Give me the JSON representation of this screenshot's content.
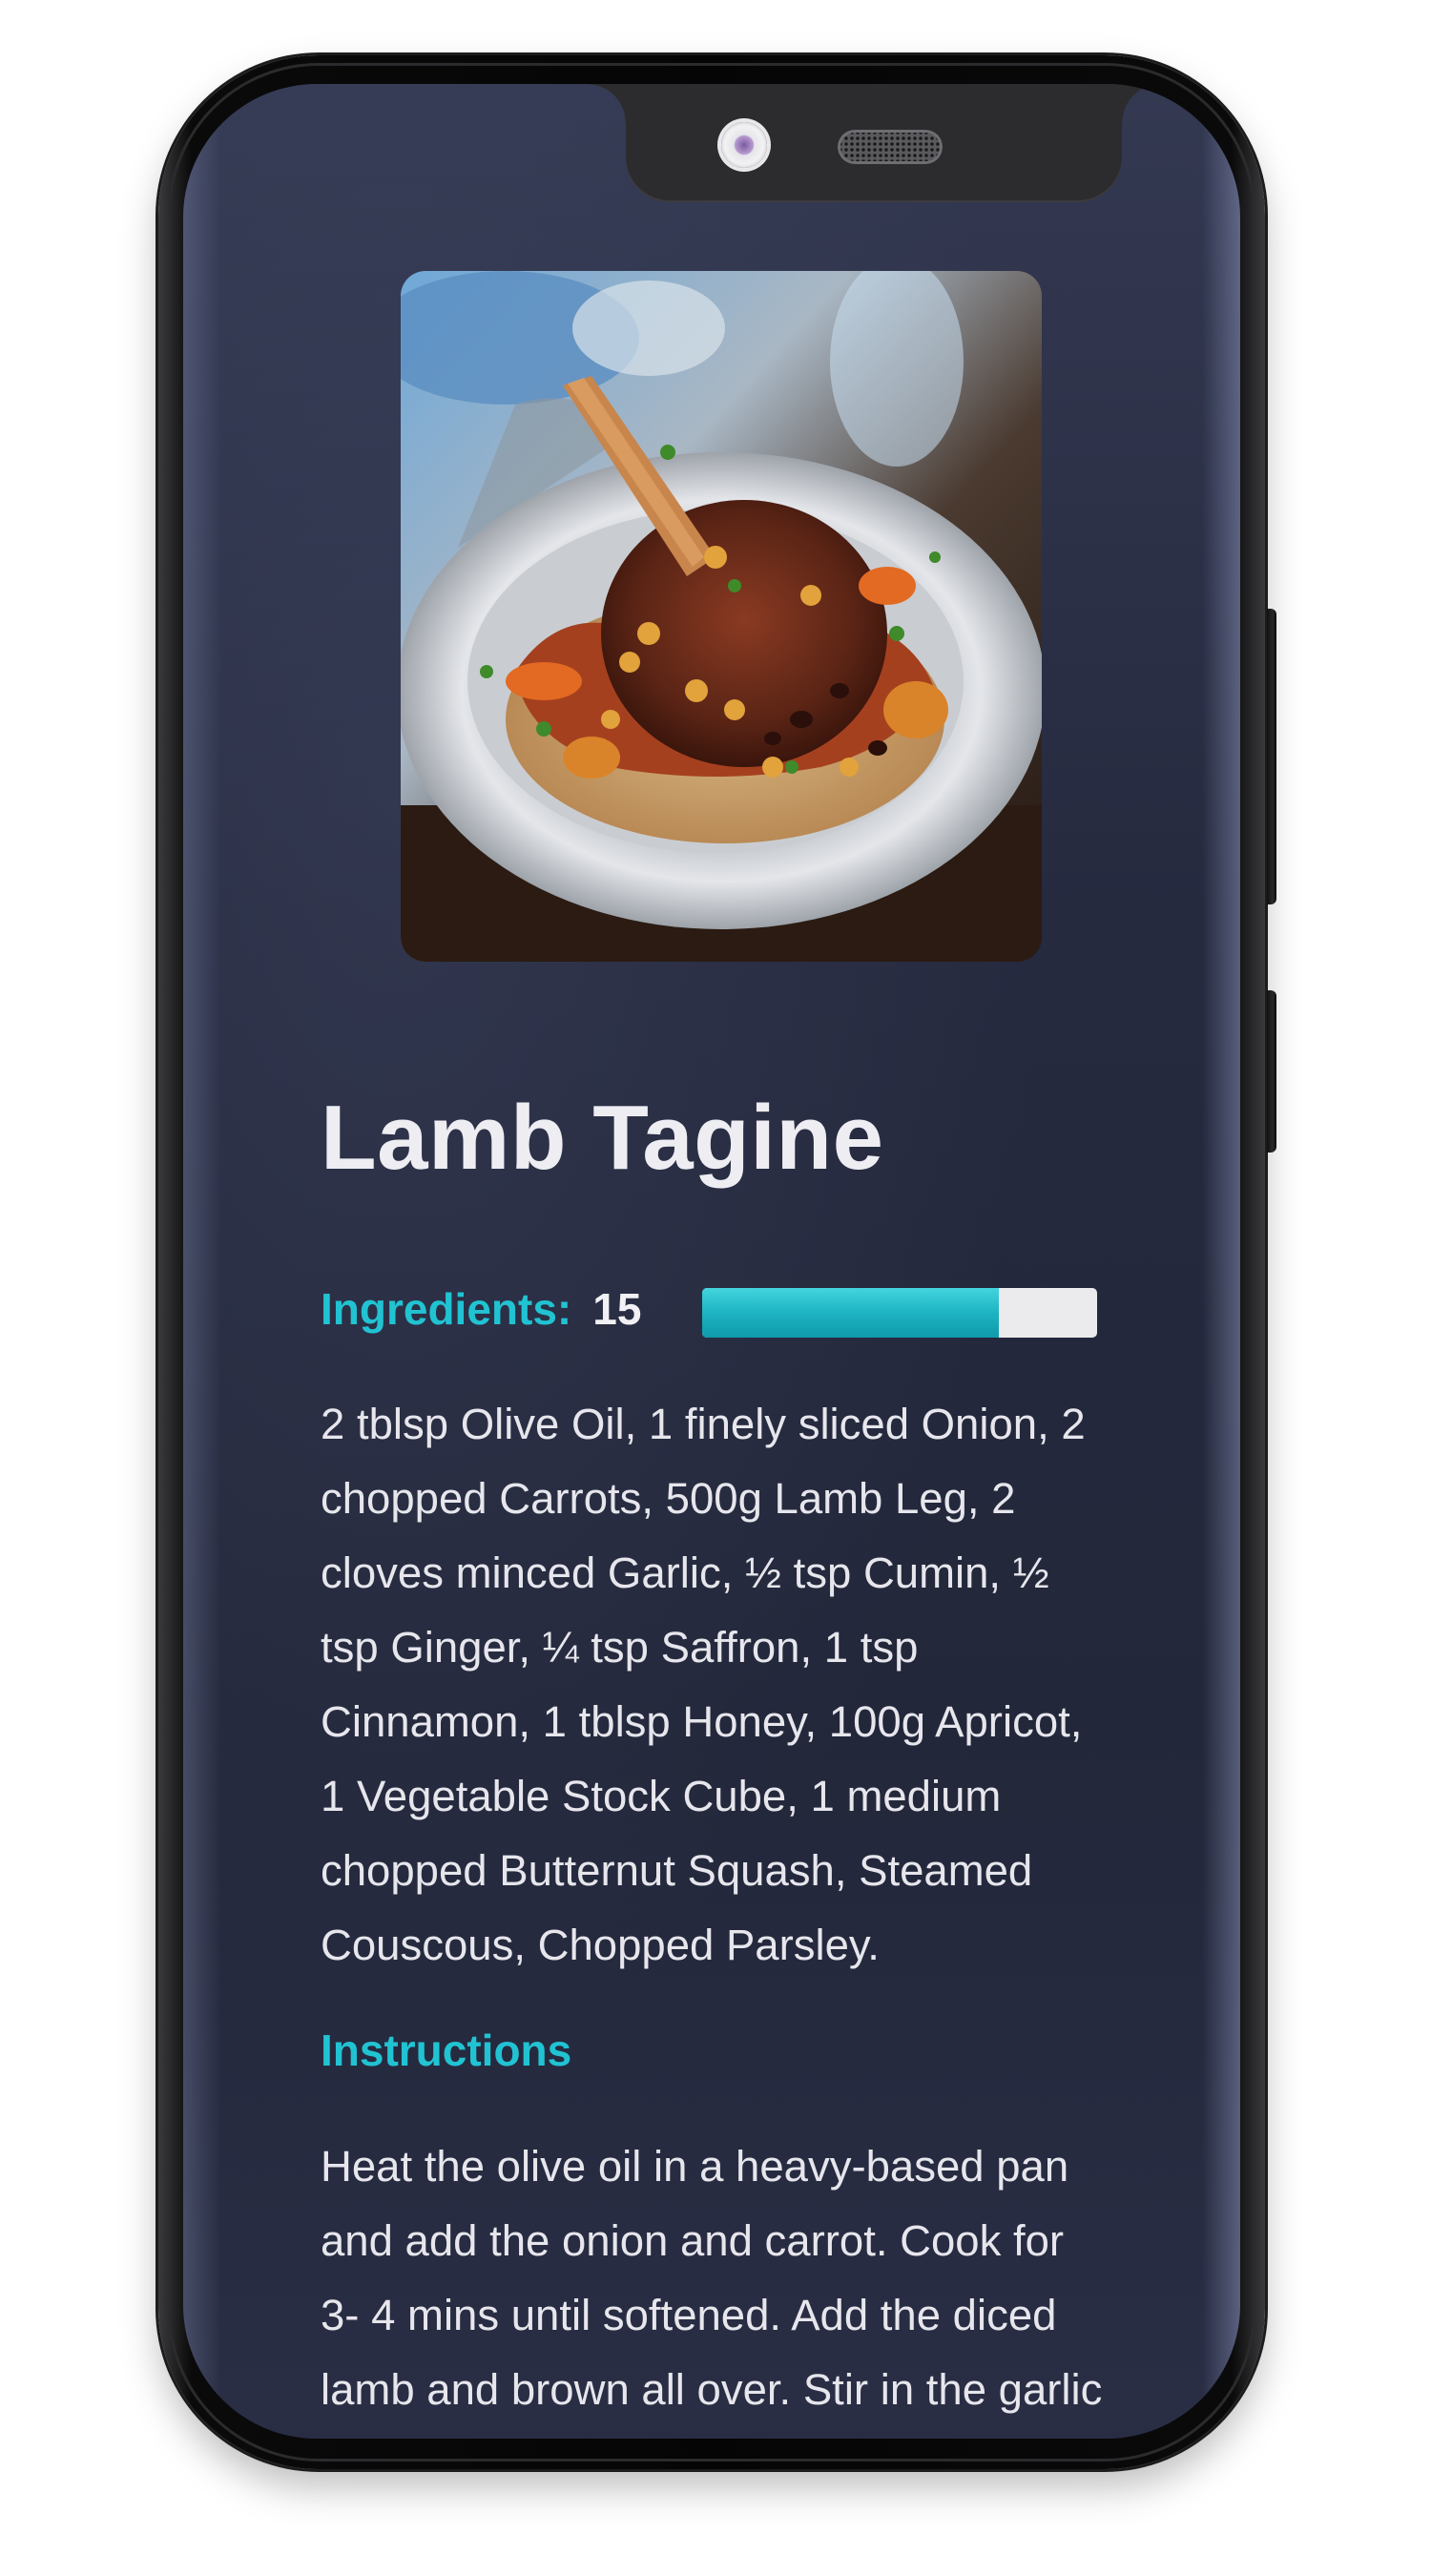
{
  "recipe": {
    "title": "Lamb Tagine",
    "photo_icon": "dish-photo",
    "ingredients_label": "Ingredients:",
    "ingredients_count": "15",
    "ingredients_progress_fraction": 0.75,
    "ingredients_text": "2 tblsp Olive Oil, 1 finely sliced Onion, 2 chopped Carrots, 500g Lamb Leg, 2 cloves minced Garlic, ½ tsp Cumin, ½ tsp Ginger, ¼ tsp Saffron, 1 tsp Cinnamon, 1 tblsp Honey, 100g Apricot, 1 Vegetable Stock Cube, 1 medium chopped Butternut Squash, Steamed Couscous, Chopped Parsley.",
    "instructions_heading": "Instructions",
    "instructions_text": "Heat the olive oil in a heavy-based pan and add the onion and carrot. Cook for 3- 4 mins until softened. Add the diced lamb and brown all over. Stir in the garlic and all the spices and cook for a"
  },
  "colors": {
    "accent": "#21c3d2",
    "background": "#262a3f",
    "text": "#e6e6ec",
    "progress_track": "#ebebee"
  }
}
